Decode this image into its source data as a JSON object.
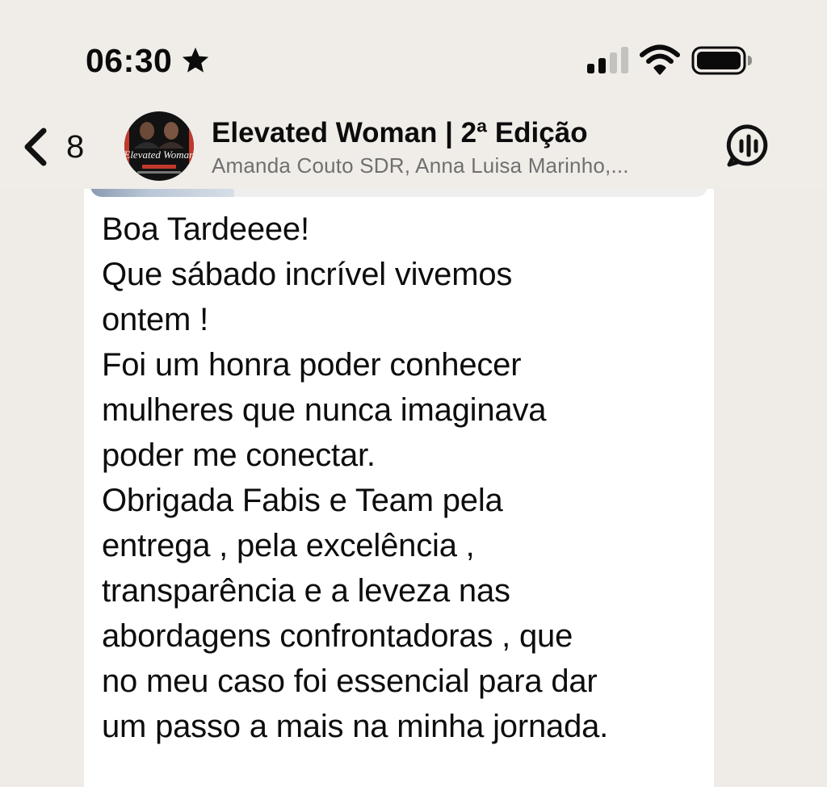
{
  "status_bar": {
    "time": "06:30",
    "icons": [
      "star-icon",
      "cellular-signal-icon",
      "wifi-icon",
      "battery-icon"
    ]
  },
  "header": {
    "back_count": "8",
    "title": "Elevated Woman | 2ª Edição",
    "subtitle": "Amanda Couto SDR, Anna Luisa Marinho,...",
    "avatar_text": "Elevated Woman",
    "icons": [
      "chevron-left-icon",
      "voice-chat-icon"
    ]
  },
  "message": {
    "lines": [
      "Boa Tardeeee!",
      "Que sábado incrível vivemos",
      "ontem !",
      "Foi um honra poder conhecer",
      "mulheres que nunca imaginava",
      "poder me conectar.",
      "Obrigada Fabis e Team pela",
      "entrega , pela excelência ,",
      "transparência e a leveza nas",
      "abordagens confrontadoras , que",
      "no meu caso foi essencial para dar",
      "um passo a mais na minha jornada."
    ]
  },
  "colors": {
    "background": "#efece7",
    "bubble": "#ffffff",
    "text": "#0d0d0d",
    "subtitle": "#707070",
    "avatar_accent": "#c0392b"
  }
}
